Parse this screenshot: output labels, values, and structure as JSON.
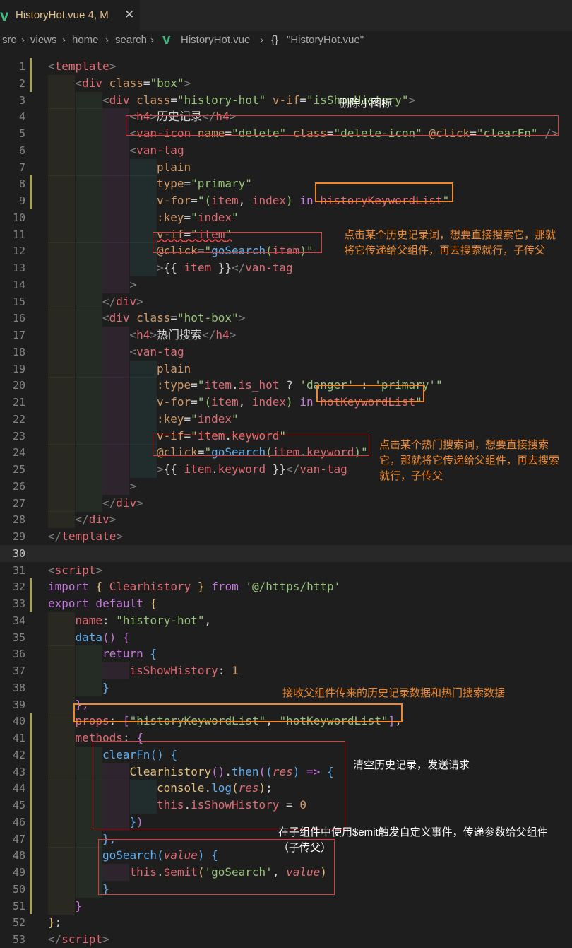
{
  "tab": {
    "title": "HistoryHot.vue",
    "status": "4, M",
    "vue_icon": "V",
    "close_icon": "✕"
  },
  "breadcrumb": {
    "items": [
      "src",
      "views",
      "home",
      "search",
      "HistoryHot.vue",
      "\"HistoryHot.vue\""
    ],
    "separator": "›",
    "vue_icon": "V",
    "braces_icon": "{}"
  },
  "editor": {
    "lines": [
      [
        [
          "br",
          "<"
        ],
        [
          "tg",
          "template"
        ],
        [
          "br",
          ">"
        ]
      ],
      [
        [
          "br",
          "<"
        ],
        [
          "tg",
          "div"
        ],
        [
          "at",
          " class"
        ],
        [
          "wh",
          "="
        ],
        [
          "st",
          "\"box\""
        ],
        [
          "br",
          ">"
        ]
      ],
      [
        [
          "br",
          "<"
        ],
        [
          "tg",
          "div"
        ],
        [
          "at",
          " class"
        ],
        [
          "wh",
          "="
        ],
        [
          "st",
          "\"history-hot\""
        ],
        [
          "at",
          " v-if"
        ],
        [
          "wh",
          "="
        ],
        [
          "st",
          "\"isShowHistory\""
        ],
        [
          "br",
          ">"
        ]
      ],
      [
        [
          "br",
          "<"
        ],
        [
          "tg",
          "h4"
        ],
        [
          "br",
          ">"
        ],
        [
          "wh",
          "历史记录"
        ],
        [
          "br",
          "</"
        ],
        [
          "tg",
          "h4"
        ],
        [
          "br",
          ">"
        ]
      ],
      [
        [
          "br",
          "<"
        ],
        [
          "tg",
          "van-icon"
        ],
        [
          "at",
          " name"
        ],
        [
          "wh",
          "="
        ],
        [
          "st",
          "\"delete\""
        ],
        [
          "at",
          " class"
        ],
        [
          "wh",
          "="
        ],
        [
          "st",
          "\"delete-icon\""
        ],
        [
          "at",
          " @click"
        ],
        [
          "wh",
          "="
        ],
        [
          "st",
          "\"clearFn\""
        ],
        [
          "br",
          " />"
        ]
      ],
      [
        [
          "br",
          "<"
        ],
        [
          "tg",
          "van-tag"
        ]
      ],
      [
        [
          "at",
          "plain"
        ]
      ],
      [
        [
          "at",
          "type"
        ],
        [
          "wh",
          "="
        ],
        [
          "st",
          "\"primary\""
        ]
      ],
      [
        [
          "at",
          "v-for"
        ],
        [
          "wh",
          "="
        ],
        [
          "st",
          "\"("
        ],
        [
          "va",
          "item"
        ],
        [
          "wh",
          ", "
        ],
        [
          "va",
          "index"
        ],
        [
          "st",
          ") "
        ],
        [
          "kw",
          "in"
        ],
        [
          "st",
          " "
        ],
        [
          "va",
          "historyKeywordList"
        ],
        [
          "st",
          "\""
        ]
      ],
      [
        [
          "at",
          ":key"
        ],
        [
          "wh",
          "="
        ],
        [
          "st",
          "\""
        ],
        [
          "va",
          "index"
        ],
        [
          "st",
          "\""
        ]
      ],
      [
        [
          "at",
          "v-if"
        ],
        [
          "wh",
          "="
        ],
        [
          "st",
          "\""
        ],
        [
          "va",
          "item"
        ],
        [
          "st",
          "\""
        ]
      ],
      [
        [
          "at",
          "@click"
        ],
        [
          "wh",
          "="
        ],
        [
          "st",
          "\""
        ],
        [
          "fn",
          "goSearch"
        ],
        [
          "st",
          "("
        ],
        [
          "va",
          "item"
        ],
        [
          "st",
          ")\""
        ]
      ],
      [
        [
          "br",
          ">"
        ],
        [
          "wh",
          "{{ "
        ],
        [
          "va",
          "item"
        ],
        [
          "wh",
          " }}"
        ],
        [
          "br",
          "</"
        ],
        [
          "tg",
          "van-tag"
        ]
      ],
      [
        [
          "br",
          ">"
        ]
      ],
      [
        [
          "br",
          "</"
        ],
        [
          "tg",
          "div"
        ],
        [
          "br",
          ">"
        ]
      ],
      [
        [
          "br",
          "<"
        ],
        [
          "tg",
          "div"
        ],
        [
          "at",
          " class"
        ],
        [
          "wh",
          "="
        ],
        [
          "st",
          "\"hot-box\""
        ],
        [
          "br",
          ">"
        ]
      ],
      [
        [
          "br",
          "<"
        ],
        [
          "tg",
          "h4"
        ],
        [
          "br",
          ">"
        ],
        [
          "wh",
          "热门搜索"
        ],
        [
          "br",
          "</"
        ],
        [
          "tg",
          "h4"
        ],
        [
          "br",
          ">"
        ]
      ],
      [
        [
          "br",
          "<"
        ],
        [
          "tg",
          "van-tag"
        ]
      ],
      [
        [
          "at",
          "plain"
        ]
      ],
      [
        [
          "at",
          ":type"
        ],
        [
          "wh",
          "="
        ],
        [
          "st",
          "\""
        ],
        [
          "va",
          "item"
        ],
        [
          "wh",
          "."
        ],
        [
          "va",
          "is_hot"
        ],
        [
          "wh",
          " ? "
        ],
        [
          "st",
          "'danger'"
        ],
        [
          "wh",
          " : "
        ],
        [
          "st",
          "'primary'"
        ],
        [
          "st",
          "\""
        ]
      ],
      [
        [
          "at",
          "v-for"
        ],
        [
          "wh",
          "="
        ],
        [
          "st",
          "\"("
        ],
        [
          "va",
          "item"
        ],
        [
          "wh",
          ", "
        ],
        [
          "va",
          "index"
        ],
        [
          "st",
          ") "
        ],
        [
          "kw",
          "in"
        ],
        [
          "st",
          " "
        ],
        [
          "va",
          "hotKeywordList"
        ],
        [
          "st",
          "\""
        ]
      ],
      [
        [
          "at",
          ":key"
        ],
        [
          "wh",
          "="
        ],
        [
          "st",
          "\""
        ],
        [
          "va",
          "index"
        ],
        [
          "st",
          "\""
        ]
      ],
      [
        [
          "at",
          "v-if"
        ],
        [
          "wh",
          "="
        ],
        [
          "st",
          "\""
        ],
        [
          "va",
          "item"
        ],
        [
          "wh",
          "."
        ],
        [
          "va",
          "keyword"
        ],
        [
          "st",
          "\""
        ]
      ],
      [
        [
          "at",
          "@click"
        ],
        [
          "wh",
          "="
        ],
        [
          "st",
          "\""
        ],
        [
          "fn",
          "goSearch"
        ],
        [
          "st",
          "("
        ],
        [
          "va",
          "item"
        ],
        [
          "wh",
          "."
        ],
        [
          "va",
          "keyword"
        ],
        [
          "st",
          ")\""
        ]
      ],
      [
        [
          "br",
          ">"
        ],
        [
          "wh",
          "{{ "
        ],
        [
          "va",
          "item"
        ],
        [
          "wh",
          "."
        ],
        [
          "va",
          "keyword"
        ],
        [
          "wh",
          " }}"
        ],
        [
          "br",
          "</"
        ],
        [
          "tg",
          "van-tag"
        ]
      ],
      [
        [
          "br",
          ">"
        ]
      ],
      [
        [
          "br",
          "</"
        ],
        [
          "tg",
          "div"
        ],
        [
          "br",
          ">"
        ]
      ],
      [
        [
          "br",
          "</"
        ],
        [
          "tg",
          "div"
        ],
        [
          "br",
          ">"
        ]
      ],
      [
        [
          "br",
          "</"
        ],
        [
          "tg",
          "template"
        ],
        [
          "br",
          ">"
        ]
      ],
      [],
      [
        [
          "br",
          "<"
        ],
        [
          "tg",
          "script"
        ],
        [
          "br",
          ">"
        ]
      ],
      [
        [
          "kw",
          "import"
        ],
        [
          "yl",
          " { "
        ],
        [
          "va",
          "Clearhistory"
        ],
        [
          "yl",
          " } "
        ],
        [
          "kw",
          "from"
        ],
        [
          "st",
          " '@/https/http'"
        ]
      ],
      [
        [
          "kw",
          "export default"
        ],
        [
          "yl",
          " {"
        ]
      ],
      [
        [
          "va",
          "name"
        ],
        [
          "wh",
          ": "
        ],
        [
          "st",
          "\"history-hot\""
        ],
        [
          "wh",
          ","
        ]
      ],
      [
        [
          "fn",
          "data"
        ],
        [
          "pk",
          "() {"
        ]
      ],
      [
        [
          "kw",
          "return"
        ],
        [
          "fn",
          " {"
        ]
      ],
      [
        [
          "va",
          "isShowHistory"
        ],
        [
          "wh",
          ": "
        ],
        [
          "nu",
          "1"
        ]
      ],
      [
        [
          "fn",
          "}"
        ]
      ],
      [
        [
          "pk",
          "},"
        ]
      ],
      [
        [
          "va",
          "props"
        ],
        [
          "wh",
          ": "
        ],
        [
          "pk",
          "["
        ],
        [
          "st",
          "\"historyKeywordList\""
        ],
        [
          "wh",
          ", "
        ],
        [
          "st",
          "\"hotKeywordList\""
        ],
        [
          "pk",
          "]"
        ],
        [
          "wh",
          ","
        ]
      ],
      [
        [
          "va",
          "methods"
        ],
        [
          "wh",
          ": "
        ],
        [
          "pk",
          "{"
        ]
      ],
      [
        [
          "fn",
          "clearFn"
        ],
        [
          "fn",
          "() {"
        ]
      ],
      [
        [
          "yl",
          "Clearhistory"
        ],
        [
          "pk",
          "()"
        ],
        [
          "wh",
          "."
        ],
        [
          "fn",
          "then"
        ],
        [
          "pk",
          "("
        ],
        [
          "fn",
          "("
        ],
        [
          "pm",
          "res"
        ],
        [
          "fn",
          ")"
        ],
        [
          "kw",
          " => "
        ],
        [
          "fn",
          "{"
        ]
      ],
      [
        [
          "yl",
          "console"
        ],
        [
          "wh",
          "."
        ],
        [
          "fn",
          "log"
        ],
        [
          "yl",
          "("
        ],
        [
          "pm",
          "res"
        ],
        [
          "yl",
          ")"
        ],
        [
          "wh",
          ";"
        ]
      ],
      [
        [
          "va",
          "this"
        ],
        [
          "wh",
          "."
        ],
        [
          "va",
          "isShowHistory"
        ],
        [
          "wh",
          " = "
        ],
        [
          "nu",
          "0"
        ]
      ],
      [
        [
          "fn",
          "}"
        ],
        [
          "pk",
          ")"
        ]
      ],
      [
        [
          "fn",
          "},"
        ]
      ],
      [
        [
          "fn",
          "goSearch"
        ],
        [
          "fn",
          "("
        ],
        [
          "pm",
          "value"
        ],
        [
          "fn",
          ") {"
        ]
      ],
      [
        [
          "va",
          "this"
        ],
        [
          "wh",
          "."
        ],
        [
          "va",
          "$emit"
        ],
        [
          "yl",
          "("
        ],
        [
          "st",
          "'goSearch'"
        ],
        [
          "wh",
          ", "
        ],
        [
          "pm",
          "value"
        ],
        [
          "yl",
          ")"
        ]
      ],
      [
        [
          "fn",
          "}"
        ]
      ],
      [
        [
          "pk",
          "}"
        ]
      ],
      [
        [
          "yl",
          "}"
        ],
        [
          "wh",
          ";"
        ]
      ],
      [
        [
          "br",
          "</"
        ],
        [
          "tg",
          "script"
        ],
        [
          "br",
          ">"
        ]
      ]
    ]
  },
  "annotations": {
    "delete_icon": "删除小图标",
    "history_click": "点击某个历史记录词，想要直接搜索它，那就将它传递给父组件，再去搜索就行，子传父",
    "hot_click": "点击某个热门搜索词，想要直接搜索它，那就将它传递给父组件，再去搜索就行，子传父",
    "props": "接收父组件传来的历史记录数据和热门搜索数据",
    "clear": "清空历史记录，发送请求",
    "emit": "在子组件中使用$emit触发自定义事件，传递参数给父组件（子传父）"
  }
}
